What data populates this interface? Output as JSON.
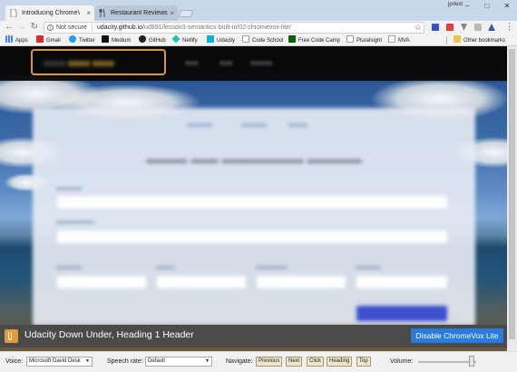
{
  "browser": {
    "tabs": [
      {
        "title": "Introducing ChromeVox",
        "close": "×"
      },
      {
        "title": "Restaurant Reviews",
        "close": "×"
      }
    ],
    "profile_name": "jprlest",
    "window_controls": {
      "minimize": "−",
      "maximize": "□",
      "close": "✕"
    },
    "address": {
      "security_label": "Not secure",
      "url_host": "udacity.github.io",
      "url_path": "/ud891/lesson3-semantics-built-in/02-chromevox-lite/"
    },
    "bookmarks": [
      {
        "label": "Apps",
        "icon": "apps-grid-icon",
        "color": "#4285f4"
      },
      {
        "label": "Gmail",
        "icon": "gmail-icon",
        "color": "#d93025"
      },
      {
        "label": "Twitter",
        "icon": "twitter-icon",
        "color": "#1da1f2"
      },
      {
        "label": "Medium",
        "icon": "medium-icon",
        "color": "#111111"
      },
      {
        "label": "GitHub",
        "icon": "github-icon",
        "color": "#222222"
      },
      {
        "label": "Netlify",
        "icon": "netlify-icon",
        "color": "#20c6b7"
      },
      {
        "label": "Udacity",
        "icon": "udacity-icon",
        "color": "#02b3e4"
      },
      {
        "label": "Code School",
        "icon": "page-icon",
        "color": "#9aa0a6"
      },
      {
        "label": "Free Code Camp",
        "icon": "freecodecamp-icon",
        "color": "#006400"
      },
      {
        "label": "Pluralsight",
        "icon": "page-icon",
        "color": "#9aa0a6"
      },
      {
        "label": "MVA",
        "icon": "page-icon",
        "color": "#9aa0a6"
      }
    ],
    "other_bookmarks": "Other bookmarks"
  },
  "chromevox": {
    "announcement": "Udacity Down Under, Heading 1 Header",
    "disable_label": "Disable ChromeVox Lite",
    "accent": "#2a7be0",
    "icon_color": "#e29a3a"
  },
  "controls": {
    "voice_label": "Voice:",
    "voice_value": "Microsoft David Desk",
    "speech_rate_label": "Speech rate:",
    "speech_rate_value": "Default",
    "navigate_label": "Navigate:",
    "nav_buttons": [
      "Previous",
      "Next",
      "Click",
      "Heading",
      "Top"
    ],
    "volume_label": "Volume:",
    "volume_level": 0.92
  },
  "site": {
    "logo_accent": "#e09436"
  }
}
